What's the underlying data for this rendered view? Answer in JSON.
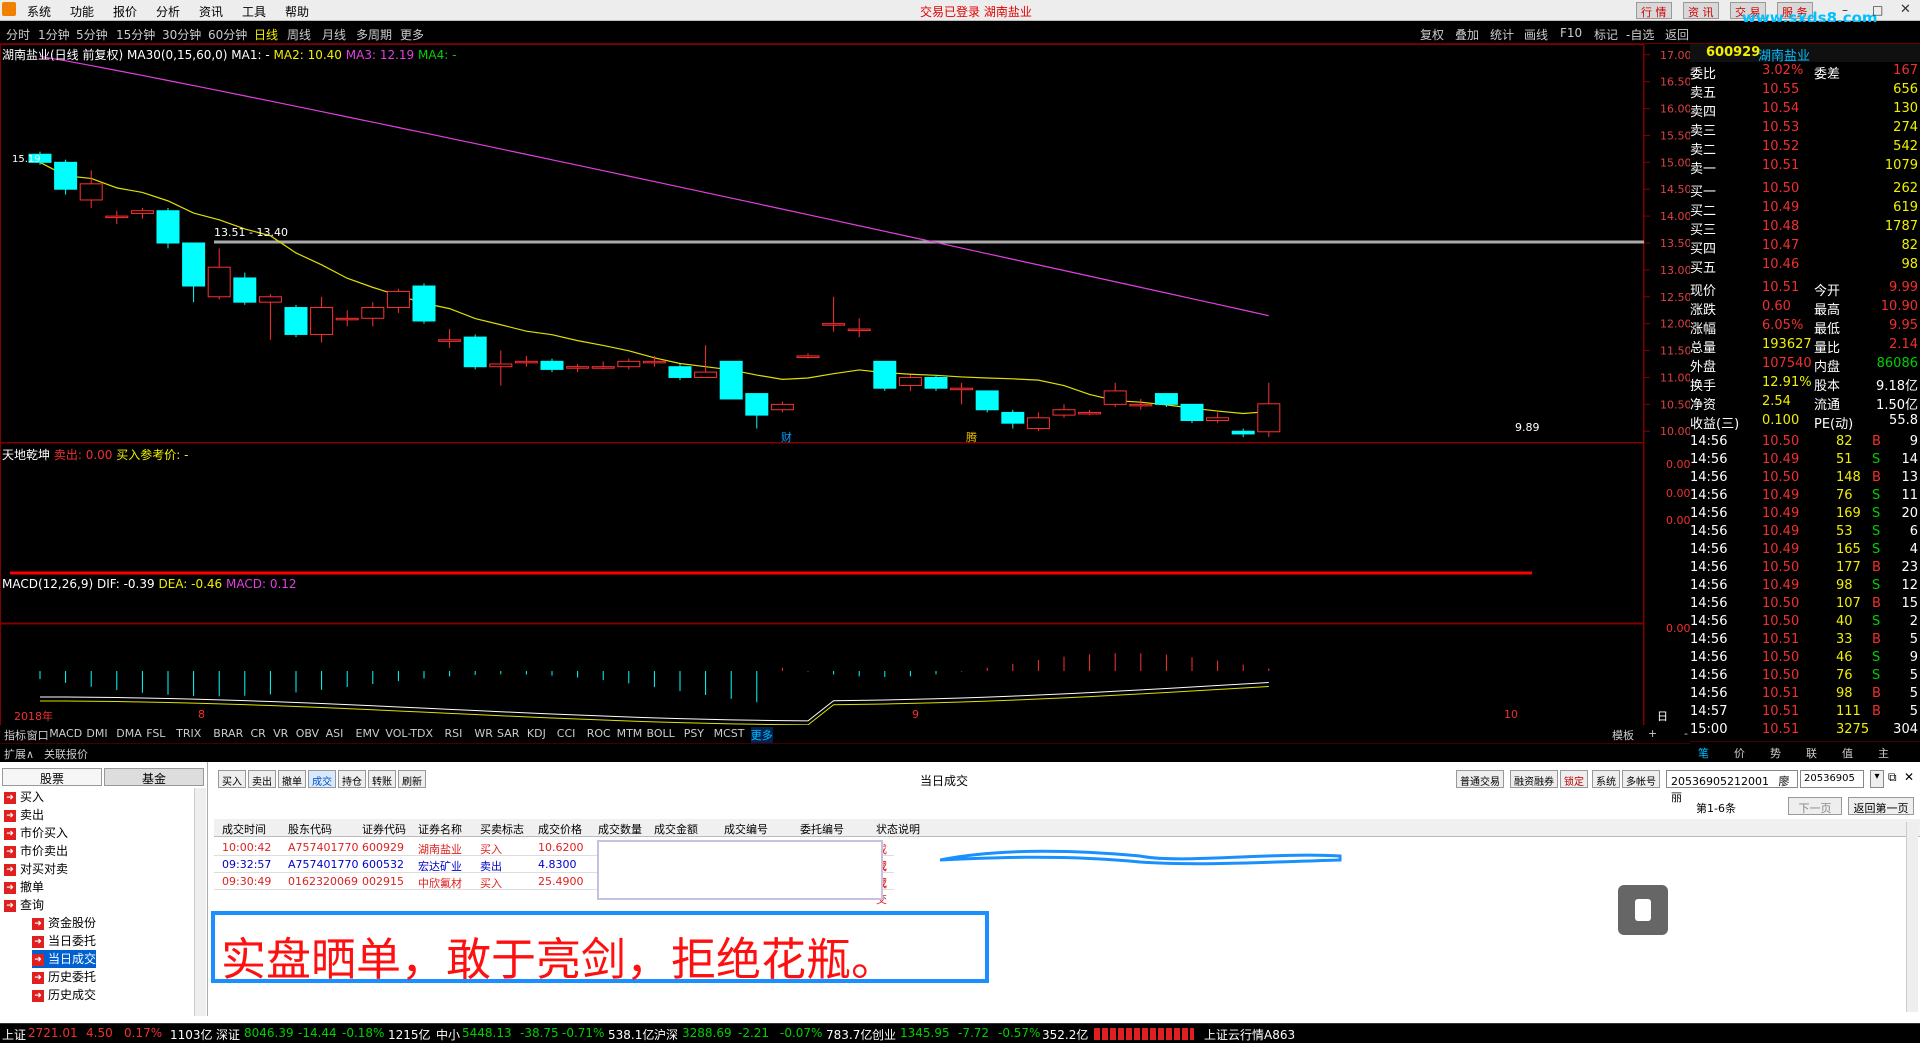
{
  "menubar": {
    "items": [
      "系统",
      "功能",
      "报价",
      "分析",
      "资讯",
      "工具",
      "帮助"
    ],
    "app_title": "交易已登录 湖南盐业",
    "right_buttons": [
      "行 情",
      "资 讯",
      "交 易",
      "服 务"
    ],
    "watermark": "www.sxds8.com"
  },
  "periods": [
    "分时",
    "1分钟",
    "5分钟",
    "15分钟",
    "30分钟",
    "60分钟",
    "日线",
    "周线",
    "月线",
    "多周期",
    "更多"
  ],
  "period_selected": "日线",
  "period_right": [
    "复权",
    "叠加",
    "统计",
    "画线",
    "F10",
    "标记",
    "-自选",
    "返回"
  ],
  "chart": {
    "legend_name": "湖南盐业(日线 前复权)",
    "legend_ma_label": "MA30(0,15,60,0)",
    "ma1": "MA1: -",
    "ma2": "MA2: 10.40",
    "ma3": "MA3: 12.19",
    "ma4": "MA4: -",
    "price_ticks": [
      "17.00",
      "16.50",
      "16.00",
      "15.50",
      "15.00",
      "14.50",
      "14.00",
      "13.50",
      "13.00",
      "12.50",
      "12.00",
      "11.50",
      "11.00",
      "10.50",
      "10.00"
    ],
    "hline_label": "13.51 - 13.40",
    "low_label": "9.89",
    "high_label": "15.19",
    "markers": [
      "财",
      "腾"
    ],
    "sub1_title": "天地乾坤",
    "sub1_label_sell": "卖出: 0.00",
    "sub1_label_buy": "买入参考价: -",
    "sub1_ticks": [
      "0.00",
      "0.00",
      "0.00"
    ],
    "macd_title": "MACD(12,26,9)",
    "macd_dif": "DIF: -0.39",
    "macd_dea": "DEA: -0.46",
    "macd_val": "MACD: 0.12",
    "macd_tick": "0.00",
    "date_labels": [
      "2018年",
      "8",
      "9",
      "10"
    ],
    "date_tag": "日线"
  },
  "chart_data": {
    "type": "candlestick",
    "candles": [
      [
        15.15,
        15.0,
        15.2,
        14.95
      ],
      [
        15.0,
        14.5,
        15.05,
        14.4
      ],
      [
        14.3,
        14.6,
        14.85,
        14.15
      ],
      [
        14.0,
        14.0,
        14.1,
        13.85
      ],
      [
        14.05,
        14.1,
        14.15,
        13.95
      ],
      [
        14.1,
        13.5,
        14.15,
        13.4
      ],
      [
        13.5,
        12.7,
        13.5,
        12.4
      ],
      [
        12.5,
        13.05,
        13.4,
        12.45
      ],
      [
        12.85,
        12.4,
        12.95,
        12.35
      ],
      [
        12.4,
        12.5,
        12.55,
        11.7
      ],
      [
        12.3,
        11.8,
        12.35,
        11.75
      ],
      [
        11.8,
        12.3,
        12.5,
        11.65
      ],
      [
        12.1,
        12.1,
        12.25,
        11.95
      ],
      [
        12.1,
        12.3,
        12.4,
        11.95
      ],
      [
        12.3,
        12.6,
        12.65,
        12.2
      ],
      [
        12.7,
        12.05,
        12.75,
        12.0
      ],
      [
        11.7,
        11.7,
        11.9,
        11.55
      ],
      [
        11.75,
        11.2,
        11.8,
        11.15
      ],
      [
        11.2,
        11.25,
        11.5,
        10.85
      ],
      [
        11.3,
        11.3,
        11.4,
        11.2
      ],
      [
        11.3,
        11.15,
        11.35,
        11.1
      ],
      [
        11.2,
        11.2,
        11.25,
        11.1
      ],
      [
        11.2,
        11.2,
        11.3,
        11.15
      ],
      [
        11.2,
        11.3,
        11.35,
        11.15
      ],
      [
        11.3,
        11.3,
        11.4,
        11.2
      ],
      [
        11.2,
        11.0,
        11.25,
        10.95
      ],
      [
        11.0,
        11.1,
        11.6,
        11.0
      ],
      [
        11.3,
        10.6,
        11.3,
        10.6
      ],
      [
        10.7,
        10.3,
        10.7,
        10.05
      ],
      [
        10.4,
        10.5,
        10.55,
        10.35
      ],
      [
        11.4,
        11.4,
        11.45,
        11.35
      ],
      [
        12.0,
        12.0,
        12.5,
        11.85
      ],
      [
        11.9,
        11.9,
        12.1,
        11.75
      ],
      [
        11.3,
        10.8,
        11.3,
        10.75
      ],
      [
        10.85,
        11.0,
        11.05,
        10.75
      ],
      [
        11.0,
        10.8,
        11.05,
        10.75
      ],
      [
        10.8,
        10.8,
        10.9,
        10.5
      ],
      [
        10.75,
        10.4,
        10.75,
        10.35
      ],
      [
        10.35,
        10.15,
        10.4,
        10.05
      ],
      [
        10.05,
        10.25,
        10.35,
        10.0
      ],
      [
        10.3,
        10.4,
        10.5,
        10.25
      ],
      [
        10.35,
        10.35,
        10.4,
        10.3
      ],
      [
        10.5,
        10.75,
        10.9,
        10.45
      ],
      [
        10.5,
        10.5,
        10.6,
        10.4
      ],
      [
        10.7,
        10.5,
        10.7,
        10.45
      ],
      [
        10.5,
        10.2,
        10.5,
        10.15
      ],
      [
        10.2,
        10.25,
        10.35,
        10.15
      ],
      [
        10.0,
        9.95,
        10.05,
        9.89
      ],
      [
        9.99,
        10.51,
        10.9,
        9.89
      ]
    ],
    "ylim": [
      9.8,
      17.2
    ]
  },
  "quote": {
    "code": "600929",
    "name": "湖南盐业",
    "weibi_label": "委比",
    "weibi": "3.02%",
    "weicha_label": "委差",
    "weicha": "167",
    "sell": [
      [
        "卖五",
        "10.55",
        "656"
      ],
      [
        "卖四",
        "10.54",
        "130"
      ],
      [
        "卖三",
        "10.53",
        "274"
      ],
      [
        "卖二",
        "10.52",
        "542"
      ],
      [
        "卖一",
        "10.51",
        "1079"
      ]
    ],
    "buy": [
      [
        "买一",
        "10.50",
        "262"
      ],
      [
        "买二",
        "10.49",
        "619"
      ],
      [
        "买三",
        "10.48",
        "1787"
      ],
      [
        "买四",
        "10.47",
        "82"
      ],
      [
        "买五",
        "10.46",
        "98"
      ]
    ],
    "stats": [
      [
        "现价",
        "10.51",
        "今开",
        "9.99"
      ],
      [
        "涨跌",
        "0.60",
        "最高",
        "10.90"
      ],
      [
        "涨幅",
        "6.05%",
        "最低",
        "9.95"
      ],
      [
        "总量",
        "193627",
        "量比",
        "2.14"
      ],
      [
        "外盘",
        "107540",
        "内盘",
        "86086"
      ],
      [
        "换手",
        "12.91%",
        "股本",
        "9.18亿"
      ],
      [
        "净资",
        "2.54",
        "流通",
        "1.50亿"
      ],
      [
        "收益(三)",
        "0.100",
        "PE(动)",
        "55.8"
      ]
    ],
    "ticks": [
      [
        "14:56",
        "10.50",
        "82",
        "B",
        "9"
      ],
      [
        "14:56",
        "10.49",
        "51",
        "S",
        "14"
      ],
      [
        "14:56",
        "10.50",
        "148",
        "B",
        "13"
      ],
      [
        "14:56",
        "10.49",
        "76",
        "S",
        "11"
      ],
      [
        "14:56",
        "10.49",
        "169",
        "S",
        "20"
      ],
      [
        "14:56",
        "10.49",
        "53",
        "S",
        "6"
      ],
      [
        "14:56",
        "10.49",
        "165",
        "S",
        "4"
      ],
      [
        "14:56",
        "10.50",
        "177",
        "B",
        "23"
      ],
      [
        "14:56",
        "10.49",
        "98",
        "S",
        "12"
      ],
      [
        "14:56",
        "10.50",
        "107",
        "B",
        "15"
      ],
      [
        "14:56",
        "10.50",
        "40",
        "S",
        "2"
      ],
      [
        "14:56",
        "10.51",
        "33",
        "B",
        "5"
      ],
      [
        "14:56",
        "10.50",
        "46",
        "S",
        "9"
      ],
      [
        "14:56",
        "10.50",
        "76",
        "S",
        "5"
      ],
      [
        "14:56",
        "10.51",
        "98",
        "B",
        "5"
      ],
      [
        "14:57",
        "10.51",
        "111",
        "B",
        "5"
      ],
      [
        "15:00",
        "10.51",
        "3275",
        "",
        " 304"
      ]
    ],
    "bottom_tabs": [
      "笔",
      "价",
      "势",
      "联",
      "值",
      "主"
    ]
  },
  "ind_tabs": [
    "指标",
    "窗口",
    "MACD",
    "DMI",
    "DMA",
    "FSL",
    "TRIX",
    "BRAR",
    "CR",
    "VR",
    "OBV",
    "ASI",
    "EMV",
    "VOL-TDX",
    "RSI",
    "WR",
    "SAR",
    "KDJ",
    "CCI",
    "ROC",
    "MTM",
    "BOLL",
    "PSY",
    "MCST",
    "更多"
  ],
  "ind_right": [
    "模板",
    "+",
    "-"
  ],
  "sec_tabs": [
    "扩展∧",
    "关联报价"
  ],
  "trade": {
    "tree_tabs": [
      "股票",
      "基金"
    ],
    "tree_items": [
      "买入",
      "卖出",
      "市价买入",
      "市价卖出",
      "对买对卖",
      "撤单",
      "查询",
      "资金股份",
      "当日委托",
      "当日成交",
      "历史委托",
      "历史成交"
    ],
    "toolbar": [
      "买入",
      "卖出",
      "撤单",
      "成交",
      "持仓",
      "转账",
      "刷新"
    ],
    "panel_title": "当日成交",
    "right_toolbar": [
      "普通交易",
      "融资融券",
      "锁定",
      "系统",
      "多帐号"
    ],
    "account": "20536905212001",
    "user": "廖丽",
    "account2": "20536905",
    "page_info": "第1-6条",
    "next_page": "下一页",
    "first_page": "返回第一页",
    "columns": [
      "成交时间",
      "股东代码",
      "证券代码",
      "证券名称",
      "买卖标志",
      "成交价格",
      "成交数量",
      "成交金额",
      "成交编号",
      "委托编号",
      "状态说明"
    ],
    "rows": [
      [
        "10:00:42",
        "A757401770",
        "600929",
        "湖南盐业",
        "买入",
        "10.6200",
        "",
        "",
        "",
        "",
        "成交"
      ],
      [
        "09:32:57",
        "A757401770",
        "600532",
        "宏达矿业",
        "卖出",
        "4.8300",
        "",
        "",
        "",
        "",
        "成交"
      ],
      [
        "09:30:49",
        "0162320069",
        "002915",
        "中欣氟材",
        "买入",
        "25.4900",
        "",
        "",
        "",
        "",
        "成交"
      ]
    ],
    "slogan": "实盘晒单，敢于亮剑，拒绝花瓶。"
  },
  "status": {
    "sh_label": "上证",
    "sh_val": "2721.01",
    "sh_chg": "4.50",
    "sh_pct": "0.17%",
    "sh_amt": "1103亿",
    "sz_label": "深证",
    "sz_val": "8046.39",
    "sz_chg": "-14.44",
    "sz_pct": "-0.18%",
    "sz_amt": "1215亿",
    "zx_label": "中小",
    "zx_val": "5448.13",
    "zx_chg": "-38.75",
    "zx_pct": "-0.71%",
    "zx_amt": "538.1亿",
    "hs_label": "沪深",
    "hs_val": "3288.69",
    "hs_chg": "-2.21",
    "hs_pct": "-0.07%",
    "hs_amt": "783.7亿",
    "cy_label": "创业",
    "cy_val": "1345.95",
    "cy_chg": "-7.72",
    "cy_pct": "-0.57%",
    "cy_amt": "352.2亿",
    "server": "上证云行情A863"
  }
}
